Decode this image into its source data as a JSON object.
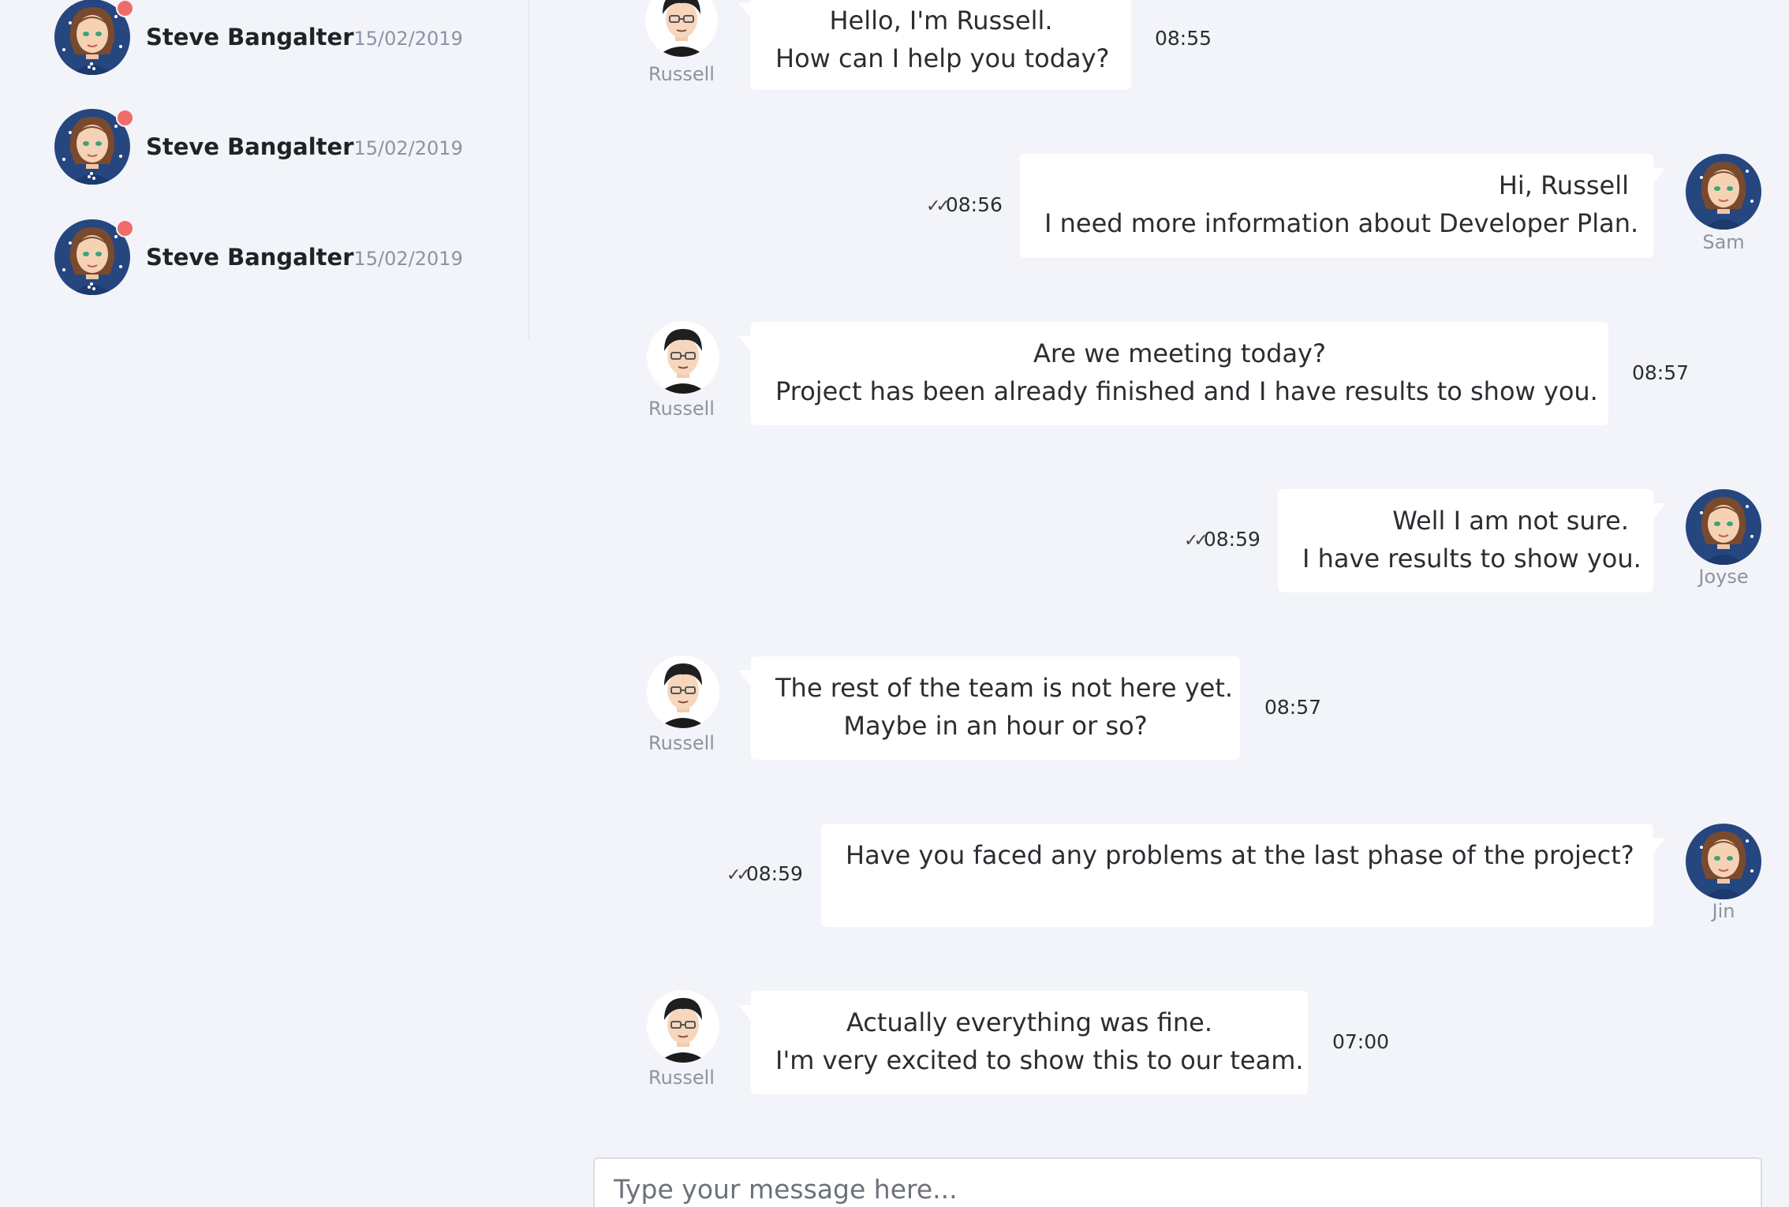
{
  "sidebar": {
    "contacts": [
      {
        "name": "Steve Bangalter",
        "date": "15/02/2019"
      },
      {
        "name": "Steve Bangalter",
        "date": "15/02/2019"
      },
      {
        "name": "Steve Bangalter",
        "date": "15/02/2019"
      }
    ]
  },
  "messages": [
    {
      "sender": "Russell",
      "lines": [
        "Hello, I'm Russell.",
        "How can I help you today?"
      ],
      "time": "08:55"
    },
    {
      "sender": "Sam",
      "lines": [
        "Hi, Russell",
        "I need more information about Developer Plan."
      ],
      "time": "08:56"
    },
    {
      "sender": "Russell",
      "lines": [
        "Are we meeting today?",
        "Project has been already finished and I have results to show you."
      ],
      "time": "08:57"
    },
    {
      "sender": "Joyse",
      "lines": [
        "Well I am not sure.",
        "I have results to show you."
      ],
      "time": "08:59"
    },
    {
      "sender": "Russell",
      "lines": [
        "The rest of the team is not here yet.",
        "Maybe in an hour or so?"
      ],
      "time": "08:57"
    },
    {
      "sender": "Jin",
      "lines": [
        "Have you faced any problems at the last phase of the project?",
        ""
      ],
      "time": "08:59"
    },
    {
      "sender": "Russell",
      "lines": [
        "Actually everything was fine.",
        "I'm very excited to show this to our team."
      ],
      "time": "07:00"
    }
  ],
  "composer": {
    "placeholder": "Type your message here..."
  },
  "colors": {
    "background": "#f3f4f9",
    "bubble": "#ffffff",
    "online_dot": "#f26b6b"
  },
  "icons": {
    "read_receipt": "double-check-icon"
  }
}
